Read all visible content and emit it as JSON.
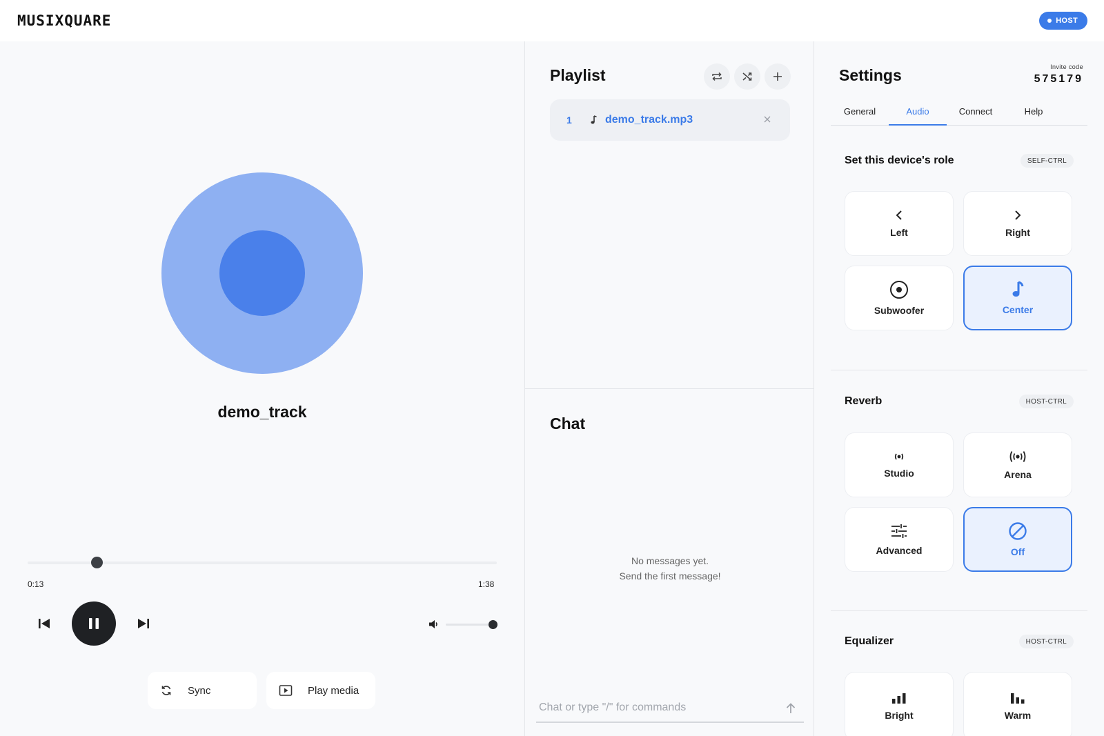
{
  "app": {
    "logo": "MUSIXQUARE",
    "host_badge": "HOST"
  },
  "player": {
    "track_title": "demo_track",
    "current_time": "0:13",
    "duration": "1:38",
    "progress_fraction": 0.147,
    "volume_fraction": 1.0,
    "sync_label": "Sync",
    "play_media_label": "Play media"
  },
  "playlist": {
    "title": "Playlist",
    "items": [
      {
        "index": "1",
        "name": "demo_track.mp3"
      }
    ]
  },
  "chat": {
    "title": "Chat",
    "empty_line1": "No messages yet.",
    "empty_line2": "Send the first message!",
    "placeholder": "Chat or type \"/\" for commands"
  },
  "settings": {
    "title": "Settings",
    "invite_label": "Invite code",
    "invite_code": "575179",
    "tabs": [
      "General",
      "Audio",
      "Connect",
      "Help"
    ],
    "active_tab": "Audio",
    "role": {
      "title": "Set this device's role",
      "badge": "SELF-CTRL",
      "options": [
        "Left",
        "Right",
        "Subwoofer",
        "Center"
      ],
      "selected": "Center"
    },
    "reverb": {
      "title": "Reverb",
      "badge": "HOST-CTRL",
      "options": [
        "Studio",
        "Arena",
        "Advanced",
        "Off"
      ],
      "selected": "Off"
    },
    "equalizer": {
      "title": "Equalizer",
      "badge": "HOST-CTRL",
      "options": [
        "Bright",
        "Warm"
      ]
    }
  },
  "colors": {
    "accent": "#3b7be8",
    "disc_outer": "#8eb0f2",
    "disc_inner": "#4a80ea",
    "dark": "#1f2124"
  }
}
